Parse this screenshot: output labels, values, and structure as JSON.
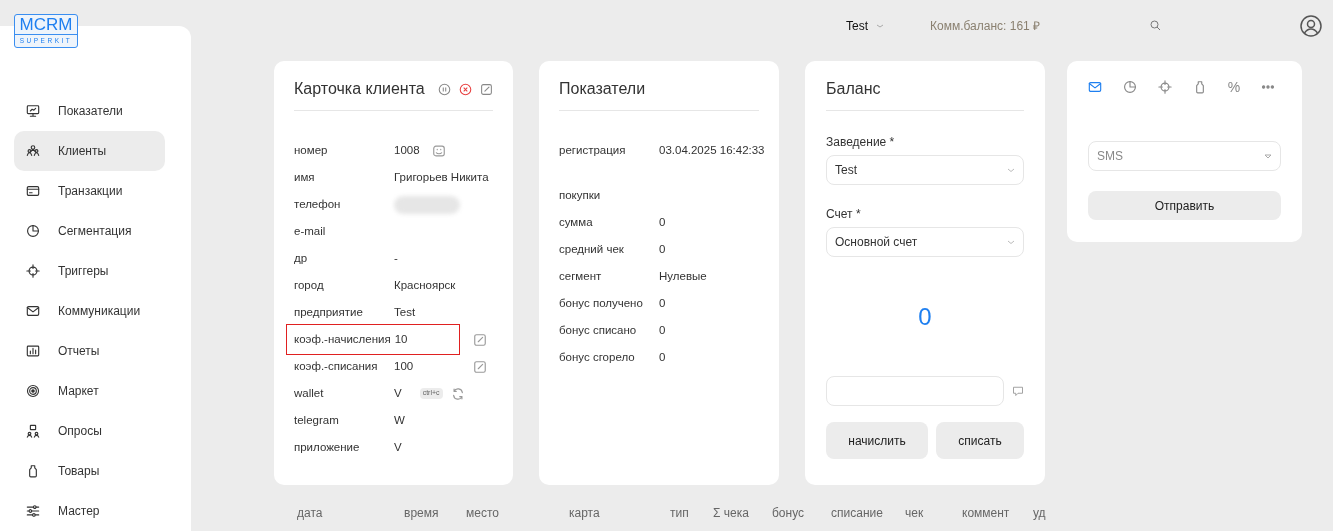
{
  "logo": {
    "title": "MCRM",
    "subtitle": "SUPERKIT"
  },
  "sidebar": {
    "items": [
      {
        "kind": "monitor",
        "label": "Показатели",
        "selected": false
      },
      {
        "kind": "people",
        "label": "Клиенты",
        "selected": true
      },
      {
        "kind": "card",
        "label": "Транзакции",
        "selected": false
      },
      {
        "kind": "pie",
        "label": "Сегментация",
        "selected": false
      },
      {
        "kind": "target",
        "label": "Триггеры",
        "selected": false
      },
      {
        "kind": "mail",
        "label": "Коммуникации",
        "selected": false
      },
      {
        "kind": "report",
        "label": "Отчеты",
        "selected": false
      },
      {
        "kind": "rings",
        "label": "Маркет",
        "selected": false
      },
      {
        "kind": "survey",
        "label": "Опросы",
        "selected": false
      },
      {
        "kind": "bag",
        "label": "Товары",
        "selected": false
      },
      {
        "kind": "sliders",
        "label": "Мастер",
        "selected": false
      }
    ]
  },
  "topbar": {
    "account": "Test",
    "balance": "Комм.баланс: 161 ₽"
  },
  "client_card": {
    "title": "Карточка клиента",
    "rows": [
      {
        "label": "номер",
        "value": "1008",
        "kind": "card"
      },
      {
        "label": "имя",
        "value": "Григорьев Никита"
      },
      {
        "label": "телефон",
        "value_hidden": true
      },
      {
        "label": "e-mail"
      },
      {
        "label": "др",
        "value": "-"
      },
      {
        "label": "город",
        "value": "Красноярск"
      },
      {
        "label": "предприятие",
        "value": "Test"
      },
      {
        "label": "коэф.-начисления",
        "value": "10",
        "kind": "edit",
        "highlighted": true
      },
      {
        "label": "коэф.-списания",
        "value": "100",
        "kind": "edit"
      },
      {
        "label": "wallet",
        "value": "V",
        "copy_hint": "ctrl+c",
        "kind": "refresh"
      },
      {
        "label": "telegram",
        "value": "W"
      },
      {
        "label": "приложение",
        "value": "V"
      }
    ]
  },
  "stats_card": {
    "title": "Показатели",
    "rows": [
      {
        "kind": "field",
        "label": "регистрация",
        "value": "03.04.2025 16:42:33"
      },
      {
        "kind": "heading",
        "label": "покупки"
      },
      {
        "kind": "field",
        "label": "сумма",
        "value": "0"
      },
      {
        "kind": "field",
        "label": "средний чек",
        "value": "0"
      },
      {
        "kind": "field",
        "label": "сегмент",
        "value": "Нулевые"
      },
      {
        "kind": "field",
        "label": "бонус получено",
        "value": "0"
      },
      {
        "kind": "field",
        "label": "бонус списано",
        "value": "0"
      },
      {
        "kind": "field",
        "label": "бонус сгорело",
        "value": "0"
      }
    ]
  },
  "balance_card": {
    "title": "Баланс",
    "fields": [
      {
        "label": "Заведение *",
        "value": "Test"
      },
      {
        "label": "Счет *",
        "value": "Основной счет"
      }
    ],
    "amount": "0",
    "buttons": [
      "начислить",
      "списать"
    ]
  },
  "message_card": {
    "tabs": [
      {
        "kind": "mail",
        "selected": true
      },
      {
        "kind": "pie",
        "selected": false
      },
      {
        "kind": "target",
        "selected": false
      },
      {
        "kind": "bag",
        "selected": false
      },
      {
        "kind": "text",
        "label": "%",
        "selected": false
      },
      {
        "kind": "dots",
        "selected": false
      }
    ],
    "channel": "SMS",
    "button": "Отправить"
  },
  "table": {
    "columns": [
      "дата",
      "время",
      "место",
      "карта",
      "тип",
      "Σ чека",
      "бонус",
      "списание",
      "чек",
      "коммент",
      "уд"
    ]
  }
}
